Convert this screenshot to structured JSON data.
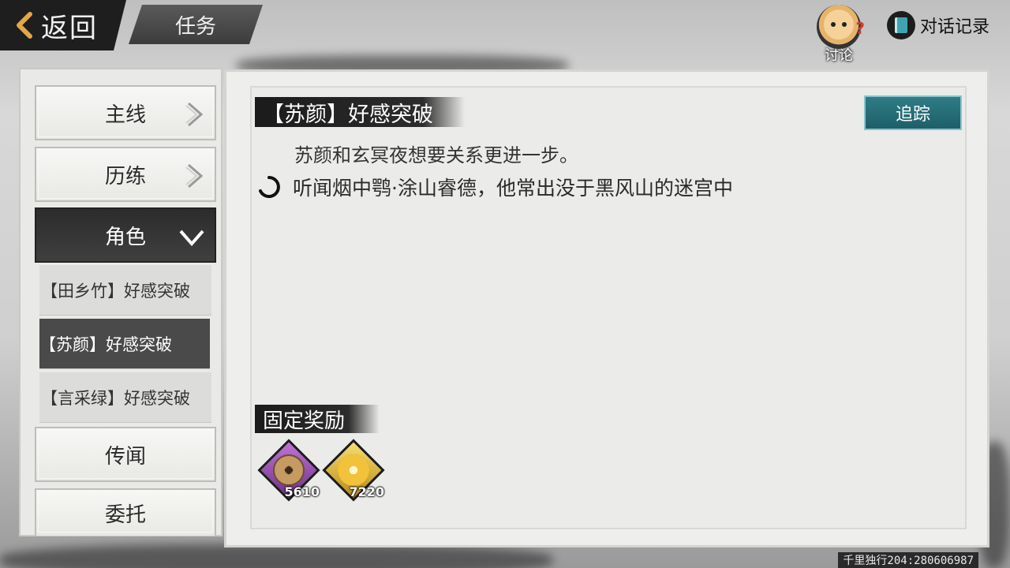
{
  "header": {
    "back_label": "返回",
    "title": "任务",
    "discuss_label": "讨论",
    "dialog_log_label": "对话记录"
  },
  "nav": {
    "main_line": "主线",
    "training": "历练",
    "character": "角色",
    "sub_items": [
      "【田乡竹】好感突破",
      "【苏颜】好感突破",
      "【言采绿】好感突破"
    ],
    "rumor": "传闻",
    "commission": "委托"
  },
  "quest": {
    "title": "【苏颜】好感突破",
    "track_label": "追踪",
    "description": "苏颜和玄冥夜想要关系更进一步。",
    "objective": "听闻烟中鹗·涂山睿德，他常出没于黑风山的迷宫中"
  },
  "rewards": {
    "title": "固定奖励",
    "items": [
      {
        "icon": "copper-coin-icon",
        "count": "5610"
      },
      {
        "icon": "gold-lotus-icon",
        "count": "7220"
      }
    ]
  },
  "watermark": "千里独行204:280606987",
  "colors": {
    "track_button": "#1d5f68",
    "active_nav": "#2c2c2c",
    "coin_frame": "#a24fbf",
    "gold_frame": "#e0b53a"
  }
}
